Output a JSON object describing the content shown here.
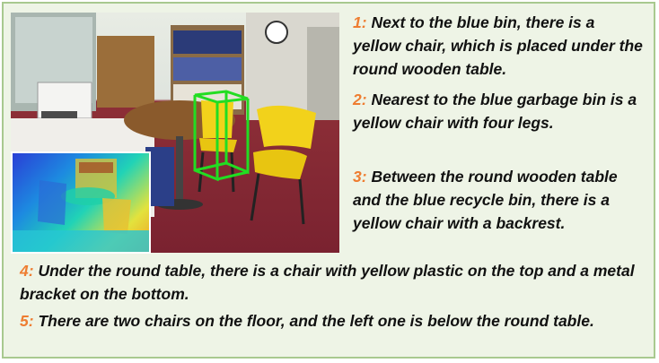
{
  "captions": [
    {
      "num": "1:",
      "text": "Next to the blue bin, there is a yellow chair, which is placed under the round wooden table."
    },
    {
      "num": "2:",
      "text": "Nearest to the blue garbage bin is a yellow chair with four legs."
    },
    {
      "num": "3:",
      "text": "Between the round wooden table and the blue recycle bin, there is a yellow chair with a backrest."
    },
    {
      "num": "4:",
      "text": "Under the round table, there is a chair with yellow plastic on the top and a metal bracket on the bottom."
    },
    {
      "num": "5:",
      "text": "There are two chairs on the floor, and the left one is below the round table."
    }
  ],
  "colors": {
    "panel_bg": "#eef4e6",
    "panel_border": "#a8c98f",
    "number_accent": "#ee7d31",
    "bbox_green": "#22dd22",
    "chair_yellow": "#f2d21b",
    "carpet_red": "#8d2f37"
  }
}
